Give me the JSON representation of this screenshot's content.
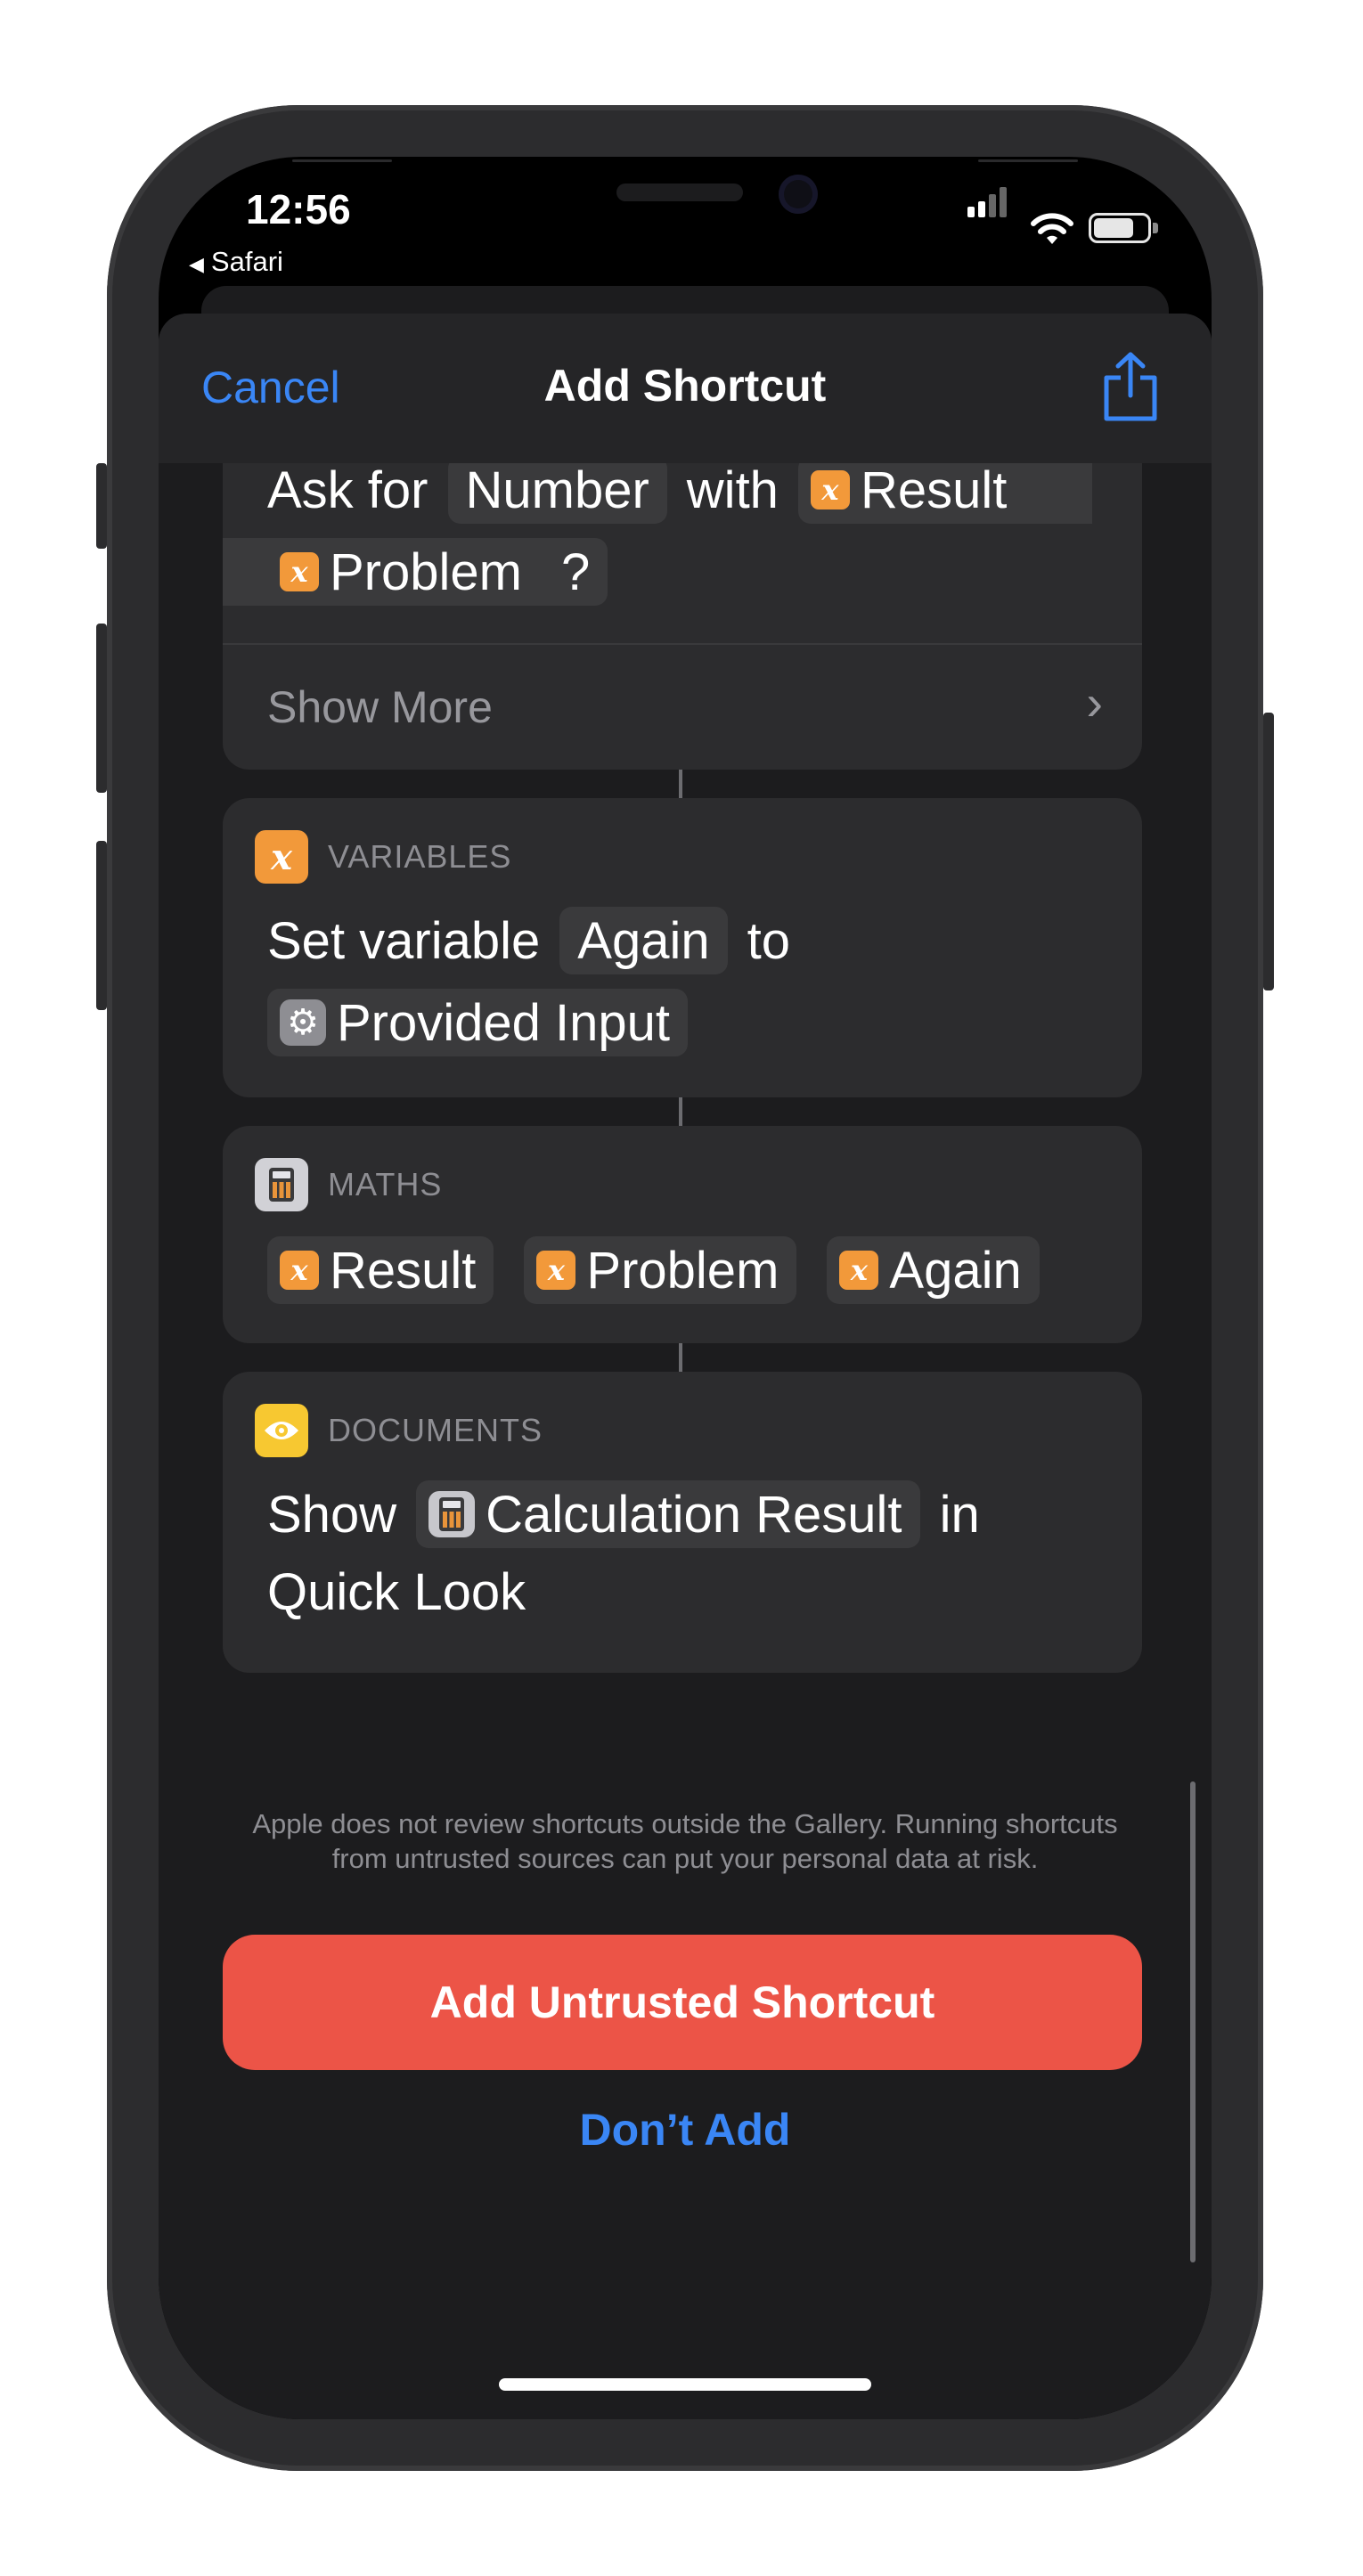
{
  "status_bar": {
    "time": "12:56",
    "back_app": "Safari"
  },
  "nav": {
    "cancel": "Cancel",
    "title": "Add Shortcut",
    "share_icon": "share-icon"
  },
  "actions": {
    "ask": {
      "word_ask_for": "Ask for",
      "type": "Number",
      "word_with": "with",
      "var1": "Result",
      "var2": "Problem",
      "suffix": "?",
      "show_more": "Show More"
    },
    "variables": {
      "category": "VARIABLES",
      "word_set": "Set variable",
      "name": "Again",
      "word_to": "to",
      "value": "Provided Input"
    },
    "maths": {
      "category": "MATHS",
      "var1": "Result",
      "var2": "Problem",
      "var3": "Again"
    },
    "documents": {
      "category": "DOCUMENTS",
      "word_show": "Show",
      "value": "Calculation Result",
      "word_in": "in",
      "line2": "Quick Look"
    }
  },
  "disclaimer": "Apple does not review shortcuts outside the Gallery. Running shortcuts from untrusted sources can put your personal data at risk.",
  "buttons": {
    "add_untrusted": "Add Untrusted Shortcut",
    "dont_add": "Don’t Add"
  },
  "colors": {
    "accent": "#3a86f5",
    "danger": "#ec5447",
    "variable": "#f2993a",
    "documents": "#f7c831"
  }
}
